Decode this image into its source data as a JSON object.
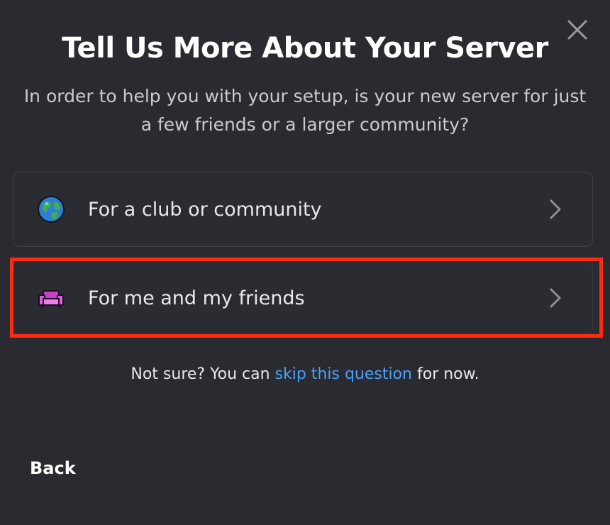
{
  "dialog": {
    "title": "Tell Us More About Your Server",
    "subtitle": "In order to help you with your setup, is your new server for just a few friends or a larger community?",
    "close_icon": "close-icon"
  },
  "options": [
    {
      "label": "For a club or community",
      "icon": "globe-icon",
      "chevron": "chevron-right-icon"
    },
    {
      "label": "For me and my friends",
      "icon": "couch-icon",
      "chevron": "chevron-right-icon",
      "highlighted": true
    }
  ],
  "skip": {
    "prefix": "Not sure? You can ",
    "link": "skip this question",
    "suffix": " for now."
  },
  "footer": {
    "back_label": "Back"
  },
  "colors": {
    "background": "#2a2b30",
    "link": "#4e9ff5",
    "highlight": "#ff2a12"
  }
}
